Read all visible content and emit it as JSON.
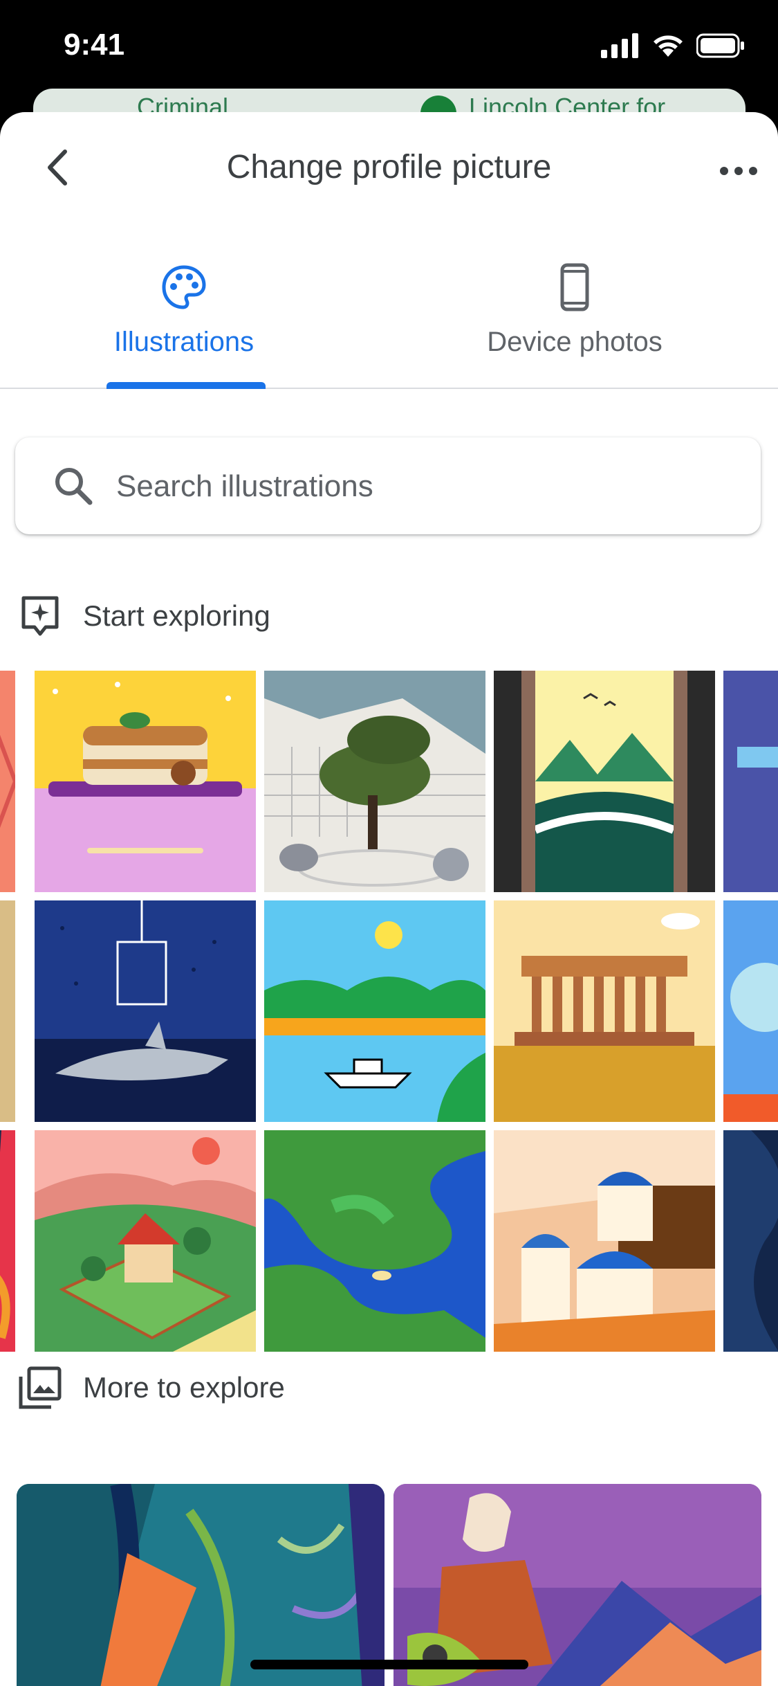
{
  "status_bar": {
    "time": "9:41"
  },
  "map_peek": {
    "labels": [
      "Criminal",
      "Lincoln Center for"
    ]
  },
  "header": {
    "title": "Change profile picture"
  },
  "tabs": [
    {
      "label": "Illustrations",
      "icon": "palette-icon",
      "selected": true
    },
    {
      "label": "Device photos",
      "icon": "smartphone-icon",
      "selected": false
    }
  ],
  "search": {
    "placeholder": "Search illustrations",
    "value": ""
  },
  "sections": {
    "start_exploring": {
      "label": "Start exploring",
      "icon": "sparkle-frame-icon"
    },
    "more_to_explore": {
      "label": "More to explore",
      "icon": "photo-library-icon"
    }
  },
  "colors": {
    "accent": "#1a73e8",
    "text_primary": "#3c4043",
    "text_secondary": "#5f6368",
    "divider": "#dadce0"
  }
}
